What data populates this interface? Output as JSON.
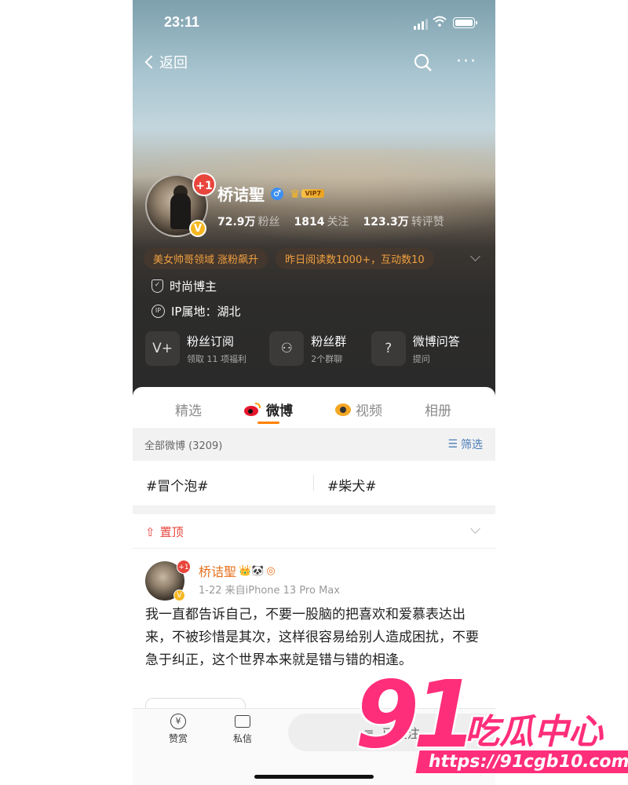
{
  "status_bar": {
    "time": "23:11"
  },
  "nav": {
    "back_label": "返回"
  },
  "profile": {
    "name": "桥诘聖",
    "badge_count": "+1",
    "verified": "V",
    "gender_symbol": "♂",
    "vip_label": "VIP7",
    "stats": [
      {
        "value": "72.9万",
        "label": "粉丝"
      },
      {
        "value": "1814",
        "label": "关注"
      },
      {
        "value": "123.3万",
        "label": "转评赞"
      }
    ],
    "tags": [
      "美女帅哥领域 涨粉飙升",
      "昨日阅读数1000+，互动数10"
    ],
    "role": "时尚博主",
    "ip_location": "IP属地：湖北",
    "features": [
      {
        "title": "粉丝订阅",
        "subtitle": "领取 11 项福利"
      },
      {
        "title": "粉丝群",
        "subtitle": "2个群聊"
      },
      {
        "title": "微博问答",
        "subtitle": "提问"
      }
    ]
  },
  "tabs": [
    "精选",
    "微博",
    "视频",
    "相册"
  ],
  "active_tab": "微博",
  "filter_bar": {
    "all_label": "全部微博 (3209)",
    "filter_label": "筛选"
  },
  "topics": [
    "#冒个泡#",
    "#柴犬#"
  ],
  "pinned": {
    "label": "置顶"
  },
  "post": {
    "author": "桥诘聖",
    "author_emoji": "👑🐼",
    "badge_count": "+1",
    "meta": "1-22  来自iPhone 13 Pro Max",
    "text": "我一直都告诉自己，不要一股脑的把喜欢和爱慕表达出来，不被珍惜是其次，这样很容易给别人造成困扰，不要急于纠正，这个世界本来就是错与错的相逢。"
  },
  "bottom_bar": {
    "reward_label": "赞赏",
    "message_label": "私信",
    "follow_label": "已关注"
  },
  "watermark": {
    "number": "91",
    "name": "吃瓜中心",
    "url": "https://91cgb10.com"
  },
  "colors": {
    "accent_orange": "#ff8200",
    "weibo_red": "#e6162d",
    "watermark_pink": "#ff2e7a"
  }
}
